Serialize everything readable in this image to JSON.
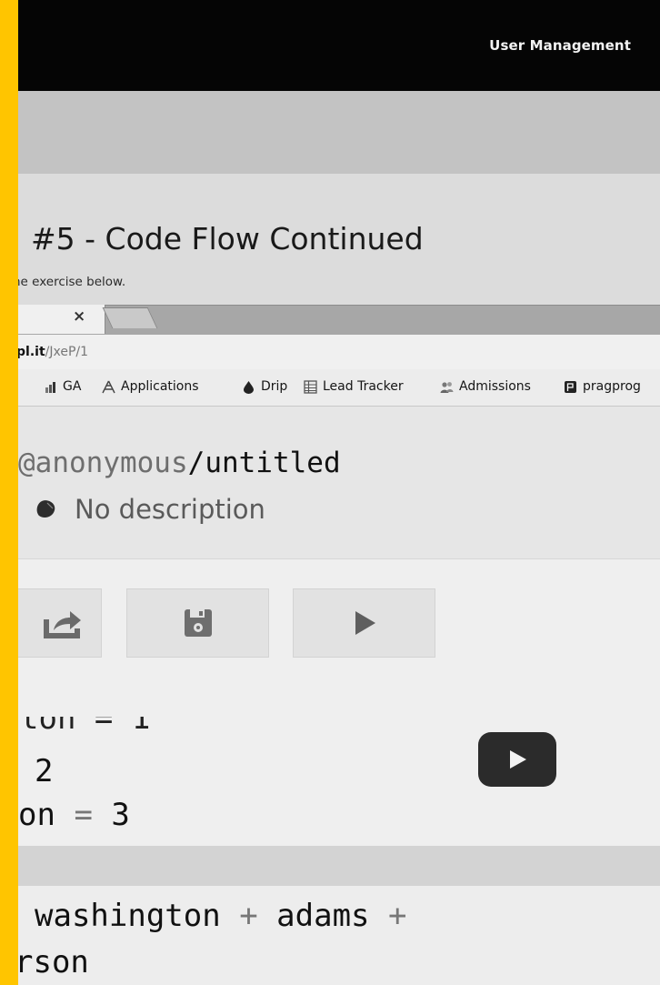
{
  "header": {
    "user_management": "User Management"
  },
  "exercise": {
    "title": "#5 - Code Flow Continued",
    "description": "he exercise below."
  },
  "browser": {
    "tab_close": "×",
    "url_host": "pl.it",
    "url_path": "/JxeP/1",
    "bookmarks": [
      {
        "label": "GA",
        "icon": "bar-chart-icon"
      },
      {
        "label": "Applications",
        "icon": "pyramid-icon"
      },
      {
        "label": "Drip",
        "icon": "drop-icon"
      },
      {
        "label": "Lead Tracker",
        "icon": "spreadsheet-icon"
      },
      {
        "label": "Admissions",
        "icon": "people-icon"
      },
      {
        "label": "pragprog",
        "icon": "book-icon"
      }
    ]
  },
  "repl": {
    "user": "@anonymous",
    "separator": "/",
    "name": "untitled",
    "description": "No description",
    "toolbar": [
      {
        "icon": "share-icon"
      },
      {
        "icon": "save-icon"
      },
      {
        "icon": "run-icon"
      }
    ]
  },
  "code_top": {
    "line1": "ton = 1",
    "line2_value": "2",
    "line3_name": "on",
    "line3_op": "=",
    "line3_value": "3"
  },
  "code_bottom": {
    "line1_a": "washington",
    "line1_plus1": "+",
    "line1_b": "adams",
    "line1_plus2": "+",
    "line2": "rson"
  },
  "colors": {
    "accent_strip": "#ffc500",
    "topbar": "#050505"
  }
}
